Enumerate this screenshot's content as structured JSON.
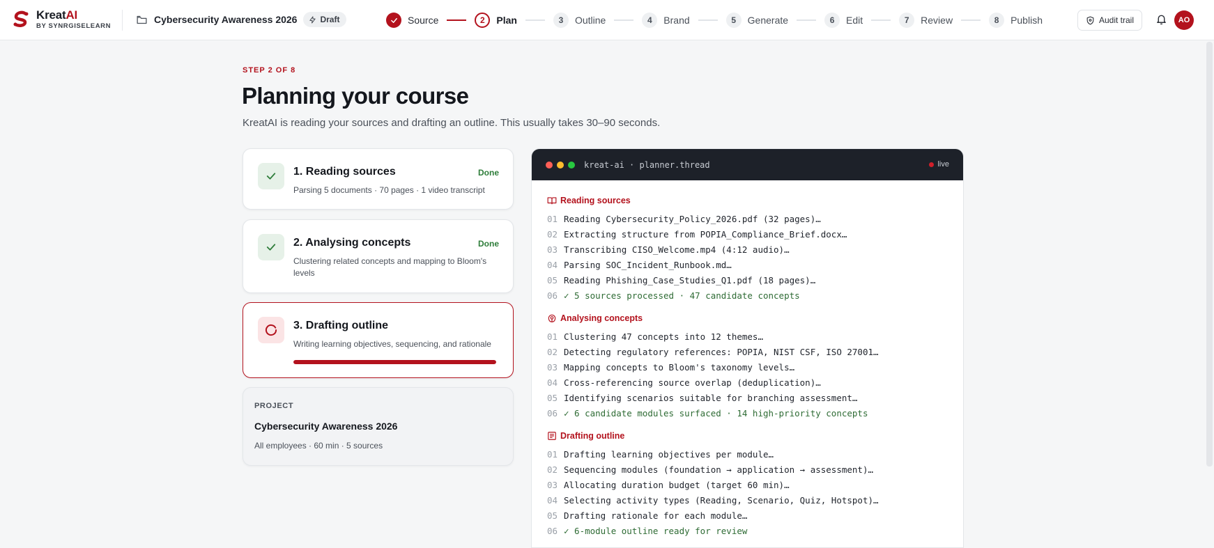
{
  "brand": {
    "name_main": "Kreat",
    "name_accent": "AI",
    "sub": "BY SYNRGISELEARN",
    "accent_color": "#b3121d"
  },
  "header": {
    "project_title": "Cybersecurity Awareness 2026",
    "status_badge": "Draft",
    "audit_label": "Audit trail",
    "avatar_initials": "AO"
  },
  "stepper": {
    "steps": [
      {
        "number": "1",
        "label": "Source",
        "state": "done"
      },
      {
        "number": "2",
        "label": "Plan",
        "state": "active"
      },
      {
        "number": "3",
        "label": "Outline",
        "state": "pending"
      },
      {
        "number": "4",
        "label": "Brand",
        "state": "pending"
      },
      {
        "number": "5",
        "label": "Generate",
        "state": "pending"
      },
      {
        "number": "6",
        "label": "Edit",
        "state": "pending"
      },
      {
        "number": "7",
        "label": "Review",
        "state": "pending"
      },
      {
        "number": "8",
        "label": "Publish",
        "state": "pending"
      }
    ]
  },
  "page": {
    "kicker": "STEP 2 OF 8",
    "title": "Planning your course",
    "subtitle": "KreatAI is reading your sources and drafting an outline. This usually takes 30–90 seconds."
  },
  "phases": [
    {
      "title": "1. Reading sources",
      "status": "Done",
      "desc": "Parsing 5 documents · 70 pages · 1 video transcript"
    },
    {
      "title": "2. Analysing concepts",
      "status": "Done",
      "desc": "Clustering related concepts and mapping to Bloom's levels"
    },
    {
      "title": "3. Drafting outline",
      "status": "",
      "desc": "Writing learning objectives, sequencing, and rationale",
      "progress": 100
    }
  ],
  "project_card": {
    "kicker": "PROJECT",
    "name": "Cybersecurity Awareness 2026",
    "meta": "All employees · 60 min · 5 sources"
  },
  "terminal": {
    "title": "kreat-ai · planner.thread",
    "live_label": "live",
    "sections": [
      {
        "heading": "Reading sources",
        "icon": "book-open-icon",
        "lines": [
          {
            "n": "01",
            "text": "Reading Cybersecurity_Policy_2026.pdf (32 pages)…"
          },
          {
            "n": "02",
            "text": "Extracting structure from POPIA_Compliance_Brief.docx…"
          },
          {
            "n": "03",
            "text": "Transcribing CISO_Welcome.mp4 (4:12 audio)…"
          },
          {
            "n": "04",
            "text": "Parsing SOC_Incident_Runbook.md…"
          },
          {
            "n": "05",
            "text": "Reading Phishing_Case_Studies_Q1.pdf (18 pages)…"
          },
          {
            "n": "06",
            "text": "✓ 5 sources processed · 47 candidate concepts",
            "ok": true
          }
        ]
      },
      {
        "heading": "Analysing concepts",
        "icon": "brain-icon",
        "lines": [
          {
            "n": "01",
            "text": "Clustering 47 concepts into 12 themes…"
          },
          {
            "n": "02",
            "text": "Detecting regulatory references: POPIA, NIST CSF, ISO 27001…"
          },
          {
            "n": "03",
            "text": "Mapping concepts to Bloom's taxonomy levels…"
          },
          {
            "n": "04",
            "text": "Cross-referencing source overlap (deduplication)…"
          },
          {
            "n": "05",
            "text": "Identifying scenarios suitable for branching assessment…"
          },
          {
            "n": "06",
            "text": "✓ 6 candidate modules surfaced · 14 high-priority concepts",
            "ok": true
          }
        ]
      },
      {
        "heading": "Drafting outline",
        "icon": "list-icon",
        "lines": [
          {
            "n": "01",
            "text": "Drafting learning objectives per module…"
          },
          {
            "n": "02",
            "text": "Sequencing modules (foundation → application → assessment)…"
          },
          {
            "n": "03",
            "text": "Allocating duration budget (target 60 min)…"
          },
          {
            "n": "04",
            "text": "Selecting activity types (Reading, Scenario, Quiz, Hotspot)…"
          },
          {
            "n": "05",
            "text": "Drafting rationale for each module…"
          },
          {
            "n": "06",
            "text": "✓ 6-module outline ready for review",
            "ok": true
          }
        ]
      }
    ]
  }
}
